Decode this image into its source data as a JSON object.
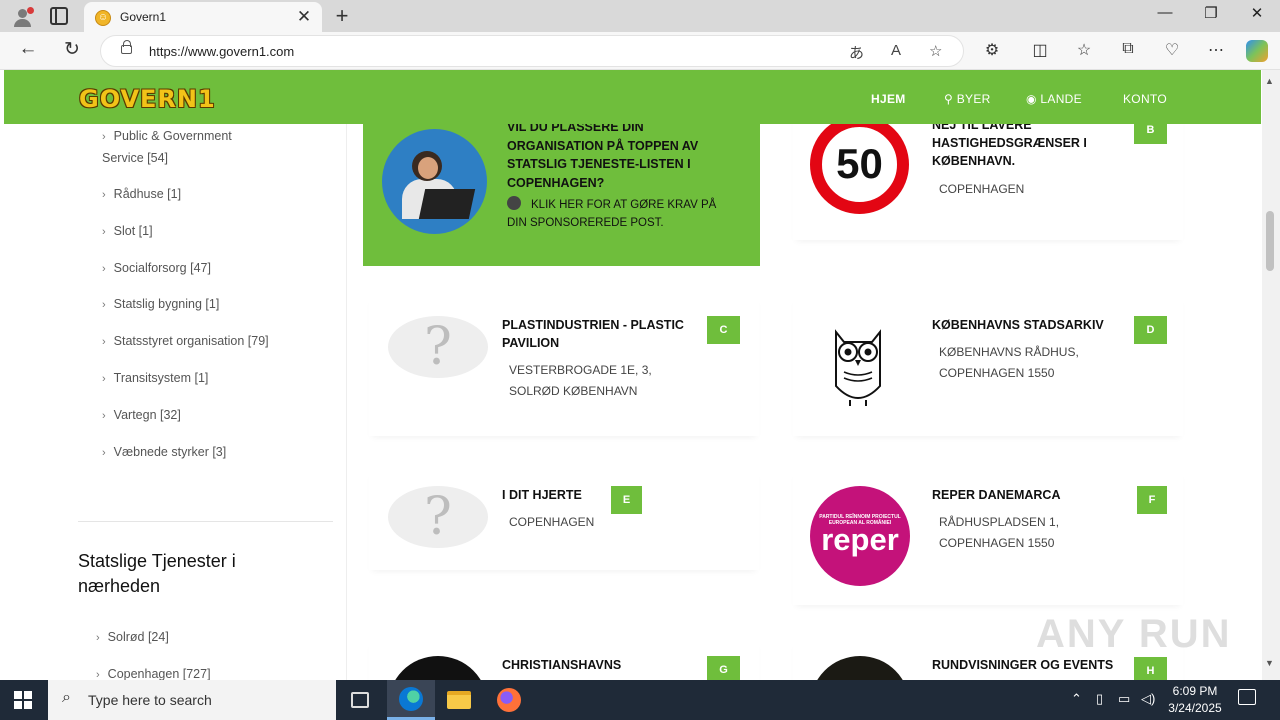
{
  "browser": {
    "tab_title": "Govern1",
    "tab_favicon": "govern1-favicon",
    "url": "https://www.govern1.com",
    "close_tab": "✕",
    "new_tab": "+",
    "window": {
      "minimize": "—",
      "maximize": "❐",
      "close": "✕"
    },
    "nav": {
      "back": "←",
      "refresh": "↻"
    },
    "url_icons": {
      "translate": "あ",
      "read_aloud": "A",
      "favorite": "☆"
    },
    "toolbar_icons": [
      "extensions-icon",
      "split-screen-icon",
      "favorites-icon",
      "collections-icon",
      "performance-icon",
      "more-icon",
      "copilot-icon"
    ],
    "toolbar_glyphs": {
      "extensions": "⚙",
      "split": "◫",
      "favorites": "☆",
      "collections": "⧉",
      "performance": "♡",
      "more": "⋯"
    }
  },
  "site": {
    "logo": "GOVERN1",
    "nav": {
      "home": "HJEM",
      "cities": "BYER",
      "countries": "LANDE",
      "account": "KONTO",
      "cities_icon": "⚲",
      "countries_icon": "◉"
    },
    "accent_color": "#6fbe3c"
  },
  "sidebar": {
    "categories": [
      {
        "label": "Public & Government Service [54]"
      },
      {
        "label": "Rådhuse [1]"
      },
      {
        "label": "Slot [1]"
      },
      {
        "label": "Socialforsorg [47]"
      },
      {
        "label": "Statslig bygning [1]"
      },
      {
        "label": "Statsstyret organisation [79]"
      },
      {
        "label": "Transitsystem [1]"
      },
      {
        "label": "Vartegn [32]"
      },
      {
        "label": "Væbnede styrker [3]"
      }
    ],
    "nearby_title": "Statslige Tjenester i nærheden",
    "nearby": [
      {
        "label": "Solrød [24]"
      },
      {
        "label": "Copenhagen [727]"
      }
    ],
    "chevron": "›"
  },
  "promo": {
    "title": "VIL DU PLASSERE DIN ORGANISATION PÅ TOPPEN AV STATSLIG TJENESTE-LISTEN I COPENHAGEN?",
    "cta": "KLIK HER FOR AT GØRE KRAV PÅ DIN SPONSOREREDE POST."
  },
  "listings": [
    {
      "badge": "B",
      "title": "NEJ TIL LAVERE HASTIGHEDSGRÆNSER I KØBENHAVN.",
      "address": "COPENHAGEN",
      "image": "speed-limit-50-sign",
      "image_text": "50"
    },
    {
      "badge": "C",
      "title": "PLASTINDUSTRIEN - PLASTIC PAVILION",
      "address": "VESTERBROGADE 1E, 3, SOLRØD KØBENHAVN",
      "image": "placeholder-question-mark",
      "image_text": "?"
    },
    {
      "badge": "D",
      "title": "KØBENHAVNS STADSARKIV",
      "address": "KØBENHAVNS RÅDHUS, COPENHAGEN 1550",
      "image": "owl-logo"
    },
    {
      "badge": "E",
      "title": "I DIT HJERTE",
      "address": "COPENHAGEN",
      "image": "placeholder-question-mark",
      "image_text": "?"
    },
    {
      "badge": "F",
      "title": "REPER DANEMARCA",
      "address": "RÅDHUSPLADSEN 1, COPENHAGEN 1550",
      "image": "reper-logo",
      "image_text": "reper",
      "image_small_text": "PARTIDUL REÎNNOIM PROIECTUL EUROPEAN AL ROMÂNIEI"
    },
    {
      "badge": "G",
      "title": "CHRISTIANSHAVNS",
      "image": "black-circle-logo"
    },
    {
      "badge": "H",
      "title": "RUNDVISNINGER OG EVENTS",
      "image": "black-circle-logo"
    }
  ],
  "watermark": "ANY RUN",
  "taskbar": {
    "search_placeholder": "Type here to search",
    "time": "6:09 PM",
    "date": "3/24/2025",
    "apps": [
      "task-view-icon",
      "edge-icon",
      "file-explorer-icon",
      "firefox-icon"
    ],
    "tray_glyphs": {
      "chevron": "⌃",
      "network": "▭",
      "volume": "🔊"
    }
  }
}
